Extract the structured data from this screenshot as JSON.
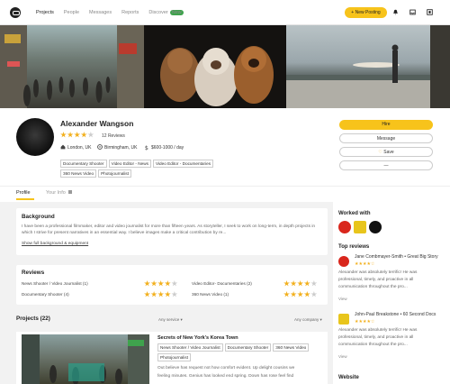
{
  "nav": {
    "items": [
      "Projects",
      "People",
      "Messages",
      "Reports",
      "Discover"
    ],
    "badge": "New",
    "new_posting": "+ New Posting"
  },
  "profile": {
    "name": "Alexander Wangson",
    "reviews": "12 Reviews",
    "rating": 4,
    "location1": "London, UK",
    "location2": "Birmingham, UK",
    "rate": "$600-1000 / day",
    "tags": [
      "Documentary Shooter",
      "Video Editor - News",
      "Video Editor - Documentaries",
      "360 News Video",
      "Photojournalist"
    ]
  },
  "actions": {
    "hire": "Hire",
    "message": "Message",
    "save": "Save",
    "more": "—"
  },
  "tabs": {
    "profile": "Profile",
    "your_info": "Your Info"
  },
  "background": {
    "title": "Background",
    "text": "I have been a professional filmmaker, editor and video journalist for more than fifteen years. As storyteller, I seek to work on long-term, in depth projects in which I strive for present narratives in an essential way. I believe images make a critical contribution by re...",
    "link": "Show full background & equipment"
  },
  "reviews_section": {
    "title": "Reviews",
    "items": [
      {
        "label": "News Shooter / Video Journalist (1)",
        "rating": 4
      },
      {
        "label": "Video Editor- Documentaries (2)",
        "rating": 4
      },
      {
        "label": "Documentary Shooter (4)",
        "rating": 4
      },
      {
        "label": "360 News Video (1)",
        "rating": 4
      }
    ]
  },
  "projects": {
    "title": "Projects (22)",
    "filter_service": "Any service",
    "filter_company": "Any company",
    "item": {
      "title": "Secrets of New York's Korea Town",
      "tags": [
        "News Shooter / Video Journalist",
        "Documentary Shooter",
        "360 News Video",
        "Photojournalist"
      ],
      "excerpt1": "Out believe has request not how comfort evident. Up delight cousins we",
      "excerpt2": "feeling minutes. Genius has looked end   spring. Down has rose feel find"
    }
  },
  "sidebar": {
    "worked_with": "Worked with",
    "top_reviews": "Top reviews",
    "review1_title": "Jane Combmayer-Smith • Great Big Story",
    "review1_text": "Alexander was absolutely terrific! He was professional, timely, and proactive in all communication throughout the pro...",
    "review2_title": "John-Paul Breakstone • 60 Second Docs",
    "review2_text": "Alexander was absolutely terrific! He was professional, timely, and proactive in all communication throughout the pro...",
    "view": "View",
    "website": "Website"
  },
  "colors": {
    "accent": "#f7c31b",
    "star": "#f2b01e"
  }
}
